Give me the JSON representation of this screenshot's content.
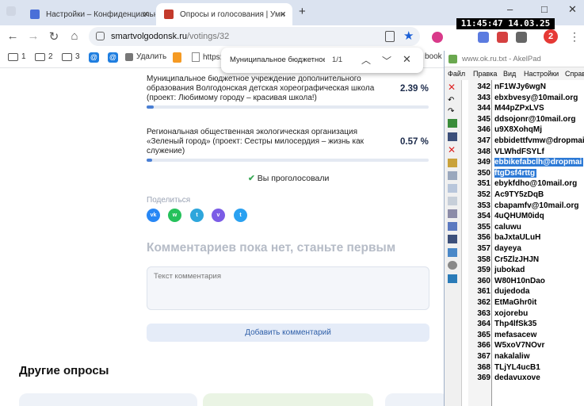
{
  "browser": {
    "tabs": [
      {
        "title": "Настройки – Конфиденциальн",
        "favicon_color": "#4a6fd8",
        "active": false
      },
      {
        "title": "Опросы и голосования | Умн",
        "favicon_color": "#c33a2b",
        "active": true
      }
    ],
    "new_tab_label": "+",
    "window_controls": {
      "minimize": "–",
      "maximize": "□",
      "close": "✕"
    },
    "nav": {
      "back": "←",
      "forward": "→",
      "reload": "↻",
      "home": "⌂"
    },
    "url": {
      "host": "smartvolgodonsk.ru",
      "path": "/votings/32"
    },
    "bookmarks": [
      {
        "label": "1",
        "icon": "folder-icon"
      },
      {
        "label": "2",
        "icon": "folder-icon"
      },
      {
        "label": "3",
        "icon": "folder-icon"
      },
      {
        "label": "",
        "icon": "at-icon"
      },
      {
        "label": "",
        "icon": "at-icon"
      },
      {
        "label": "Удалить",
        "icon": "puzzle-icon"
      },
      {
        "label": "",
        "icon": "ok-icon"
      },
      {
        "label": "https:",
        "icon": "page-icon"
      }
    ],
    "bookmark_tail": "book",
    "profile_initial": "2"
  },
  "find": {
    "query": "Муниципальное бюджетное у",
    "count": "1/1"
  },
  "clock": "11:45:47 14.03.25",
  "voting": {
    "options": [
      {
        "text": "Муниципальное бюджетное учреждение дополнительного образования Волгодонская детская хореографическая школа (проект: Любимому городу – красивая школа!)",
        "percent": "2.39 %",
        "value": 2.39
      },
      {
        "text": "Региональная общественная экологическая организация «Зеленый город» (проект: Сестры милосердия – жизнь как служение)",
        "percent": "0.57 %",
        "value": 0.57
      }
    ],
    "voted_label": "Вы проголосовали",
    "share_label": "Поделиться",
    "share_icons": [
      {
        "name": "vk",
        "label": "vk",
        "color": "#2787f5"
      },
      {
        "name": "whatsapp",
        "label": "w",
        "color": "#25c15b"
      },
      {
        "name": "telegram",
        "label": "t",
        "color": "#2ea6dc"
      },
      {
        "name": "viber",
        "label": "v",
        "color": "#7b5ce6"
      },
      {
        "name": "twitter",
        "label": "t",
        "color": "#2aa1f1"
      }
    ],
    "comments_heading": "Комментариев пока нет, станьте первым",
    "comment_placeholder": "Текст комментария",
    "add_comment_button": "Добавить комментарий",
    "other_polls_heading": "Другие опросы"
  },
  "akelpad": {
    "title": "www.ok.ru.txt - AkelPad",
    "menu": [
      "Файл",
      "Правка",
      "Вид",
      "Настройки",
      "Справ"
    ],
    "lines": [
      {
        "n": "342",
        "text": "nF1WJy6wgN"
      },
      {
        "n": "343",
        "text": "ebxbvesy@10mail.org"
      },
      {
        "n": "344",
        "text": "M44pZPxLVS"
      },
      {
        "n": "345",
        "text": "ddsojonr@10mail.org"
      },
      {
        "n": "346",
        "text": "u9X8XohqMj"
      },
      {
        "n": "347",
        "text": "ebbidettfvmw@dropmai"
      },
      {
        "n": "348",
        "text": "VLWhdFSYLf"
      },
      {
        "n": "349",
        "text": "ebbikefabclh@dropmai",
        "selected": true
      },
      {
        "n": "350",
        "text": "ftgDsf4rttg",
        "selected": true
      },
      {
        "n": "351",
        "text": "ebykfdho@10mail.org"
      },
      {
        "n": "352",
        "text": "Ac9TY5zDqB"
      },
      {
        "n": "353",
        "text": "cbapamfv@10mail.org"
      },
      {
        "n": "354",
        "text": "4uQHUM0idq"
      },
      {
        "n": "355",
        "text": "caluwu"
      },
      {
        "n": "356",
        "text": "baJxtaULuH"
      },
      {
        "n": "357",
        "text": "dayeya"
      },
      {
        "n": "358",
        "text": "Cr5ZlzJHJN"
      },
      {
        "n": "359",
        "text": "jubokad"
      },
      {
        "n": "360",
        "text": "W80H10nDao"
      },
      {
        "n": "361",
        "text": "dujedoda"
      },
      {
        "n": "362",
        "text": "EtMaGhr0it"
      },
      {
        "n": "363",
        "text": "xojorebu"
      },
      {
        "n": "364",
        "text": "Thp4lfSk35"
      },
      {
        "n": "365",
        "text": "mefasacew"
      },
      {
        "n": "366",
        "text": "W5xoV7NOvr"
      },
      {
        "n": "367",
        "text": "nakalaliw"
      },
      {
        "n": "368",
        "text": "TLjYL4ucB1"
      },
      {
        "n": "369",
        "text": "dedavuxove"
      }
    ]
  }
}
